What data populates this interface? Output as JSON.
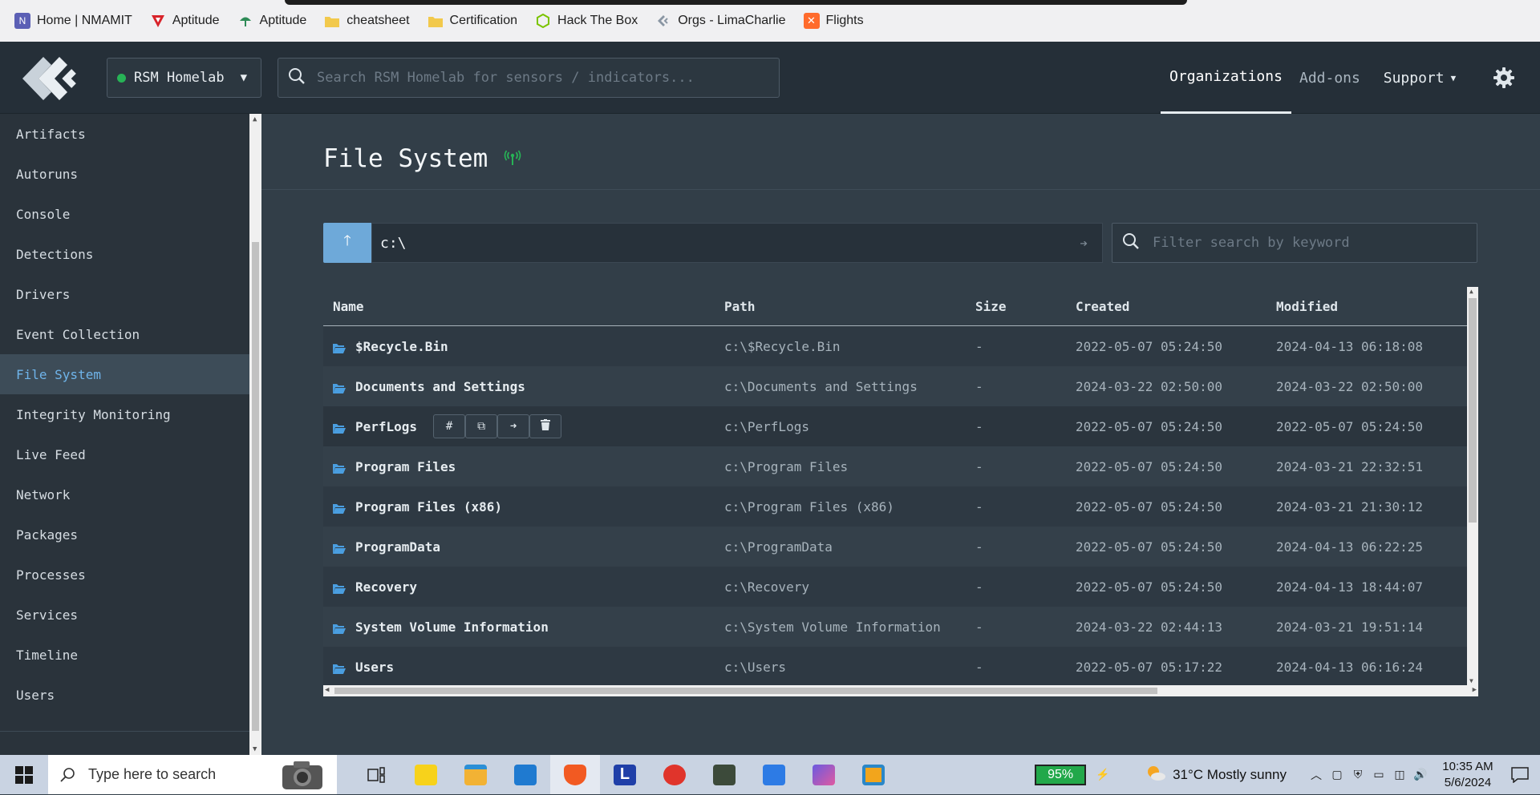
{
  "bookmarks": [
    {
      "label": "Home | NMAMIT",
      "icon": "nmamit-icon",
      "color": "#5b5fb5"
    },
    {
      "label": "Aptitude",
      "icon": "aptitude-red-icon",
      "color": "#d8232a"
    },
    {
      "label": "Aptitude",
      "icon": "aptitude-green-icon",
      "color": "#2e8b57"
    },
    {
      "label": "cheatsheet",
      "icon": "folder-icon",
      "color": "#f2c94c"
    },
    {
      "label": "Certification",
      "icon": "folder-icon",
      "color": "#f2c94c"
    },
    {
      "label": "Hack The Box",
      "icon": "hackthebox-icon",
      "color": "#9fef00"
    },
    {
      "label": "Orgs - LimaCharlie",
      "icon": "limacharlie-icon",
      "color": "#8a96a3"
    },
    {
      "label": "Flights",
      "icon": "flights-icon",
      "color": "#ff6b2c"
    }
  ],
  "topnav": {
    "org": "RSM Homelab",
    "org_status_color": "#27b356",
    "search_placeholder": "Search RSM Homelab for sensors / indicators...",
    "links": {
      "organizations": "Organizations",
      "addons": "Add-ons",
      "support": "Support"
    }
  },
  "sidebar": {
    "items": [
      {
        "label": "Artifacts"
      },
      {
        "label": "Autoruns"
      },
      {
        "label": "Console"
      },
      {
        "label": "Detections"
      },
      {
        "label": "Drivers"
      },
      {
        "label": "Event Collection"
      },
      {
        "label": "File System",
        "active": true
      },
      {
        "label": "Integrity Monitoring"
      },
      {
        "label": "Live Feed"
      },
      {
        "label": "Network"
      },
      {
        "label": "Packages"
      },
      {
        "label": "Processes"
      },
      {
        "label": "Services"
      },
      {
        "label": "Timeline"
      },
      {
        "label": "Users"
      }
    ]
  },
  "page": {
    "title": "File System",
    "path_value": "c:\\",
    "filter_placeholder": "Filter search by keyword"
  },
  "table": {
    "columns": {
      "name": "Name",
      "path": "Path",
      "size": "Size",
      "created": "Created",
      "modified": "Modified"
    },
    "rows": [
      {
        "name": "$Recycle.Bin",
        "path": "c:\\$Recycle.Bin",
        "size": "-",
        "created": "2022-05-07 05:24:50",
        "modified": "2024-04-13 06:18:08"
      },
      {
        "name": "Documents and Settings",
        "path": "c:\\Documents and Settings",
        "size": "-",
        "created": "2024-03-22 02:50:00",
        "modified": "2024-03-22 02:50:00"
      },
      {
        "name": "PerfLogs",
        "path": "c:\\PerfLogs",
        "size": "-",
        "created": "2022-05-07 05:24:50",
        "modified": "2022-05-07 05:24:50"
      },
      {
        "name": "Program Files",
        "path": "c:\\Program Files",
        "size": "-",
        "created": "2022-05-07 05:24:50",
        "modified": "2024-03-21 22:32:51"
      },
      {
        "name": "Program Files (x86)",
        "path": "c:\\Program Files (x86)",
        "size": "-",
        "created": "2022-05-07 05:24:50",
        "modified": "2024-03-21 21:30:12"
      },
      {
        "name": "ProgramData",
        "path": "c:\\ProgramData",
        "size": "-",
        "created": "2022-05-07 05:24:50",
        "modified": "2024-04-13 06:22:25"
      },
      {
        "name": "Recovery",
        "path": "c:\\Recovery",
        "size": "-",
        "created": "2022-05-07 05:24:50",
        "modified": "2024-04-13 18:44:07"
      },
      {
        "name": "System Volume Information",
        "path": "c:\\System Volume Information",
        "size": "-",
        "created": "2024-03-22 02:44:13",
        "modified": "2024-03-21 19:51:14"
      },
      {
        "name": "Users",
        "path": "c:\\Users",
        "size": "-",
        "created": "2022-05-07 05:17:22",
        "modified": "2024-04-13 06:16:24"
      }
    ],
    "row_actions": {
      "hash": "#",
      "copy": "⧉",
      "go": "➜",
      "delete": "🗑"
    }
  },
  "taskbar": {
    "search_placeholder": "Type here to search",
    "battery": "95%",
    "weather": "31°C  Mostly sunny",
    "time": "10:35 AM",
    "date": "5/6/2024"
  },
  "colors": {
    "accent": "#6ea9d9",
    "active_item_text": "#6fb4ea",
    "live_green": "#27b356"
  }
}
